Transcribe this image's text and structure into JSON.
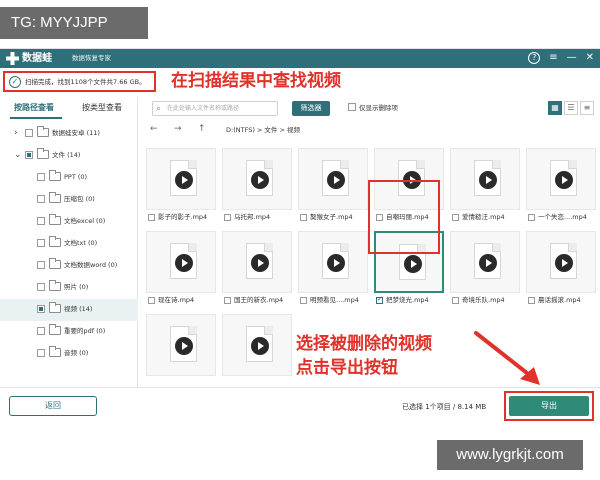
{
  "watermarks": {
    "top": "TG: MYYJJPP",
    "bottom": "www.lygrkjt.com"
  },
  "app": {
    "brand": "数据蛙",
    "subtitle": "数据恢复专家"
  },
  "scan": {
    "summary": "扫描完成，找到1108个文件共7.66 GB。"
  },
  "annotations": {
    "find_videos": "在扫描结果中查找视频",
    "select_export_line1": "选择被删除的视频",
    "select_export_line2": "点击导出按钮"
  },
  "sidebar": {
    "tab_path": "按路径查看",
    "tab_type": "按类型查看",
    "items": [
      {
        "label": "数据蛙安卓 (11)"
      },
      {
        "label": "文件 (14)"
      },
      {
        "label": "PPT (0)"
      },
      {
        "label": "压缩包 (0)"
      },
      {
        "label": "文档excel (0)"
      },
      {
        "label": "文档txt (0)"
      },
      {
        "label": "文档数据word (0)"
      },
      {
        "label": "照片 (0)"
      },
      {
        "label": "视频 (14)"
      },
      {
        "label": "重要的pdf (0)"
      },
      {
        "label": "音频 (0)"
      }
    ]
  },
  "toolbar": {
    "search_placeholder": "在此处输入文件名称或路径",
    "filter": "筛选器",
    "deleted_only": "仅显示删除项"
  },
  "path": {
    "text": "D:(NTFS) > 文件 > 视频"
  },
  "files": [
    {
      "name": "影子的影子.mp4",
      "checked": false
    },
    {
      "name": "乌托邦.mp4",
      "checked": false
    },
    {
      "name": "獒猴女子.mp4",
      "checked": false
    },
    {
      "name": "自嘲玛丽.mp4",
      "checked": false
    },
    {
      "name": "爱情糙汪.mp4",
      "checked": false
    },
    {
      "name": "一个失恋....mp4",
      "checked": false
    },
    {
      "name": "现在诗.mp4",
      "checked": false
    },
    {
      "name": "国王的新衣.mp4",
      "checked": false
    },
    {
      "name": "明预看见....mp4",
      "checked": false
    },
    {
      "name": "把梦烧光.mp4",
      "checked": true
    },
    {
      "name": "奇境乐队.mp4",
      "checked": false
    },
    {
      "name": "晨话摇滚.mp4",
      "checked": false
    },
    {
      "name": "",
      "checked": false
    },
    {
      "name": "",
      "checked": false
    }
  ],
  "footer": {
    "back": "返回",
    "status": "已选择 1个项目 / 8.14 MB",
    "export": "导出"
  }
}
